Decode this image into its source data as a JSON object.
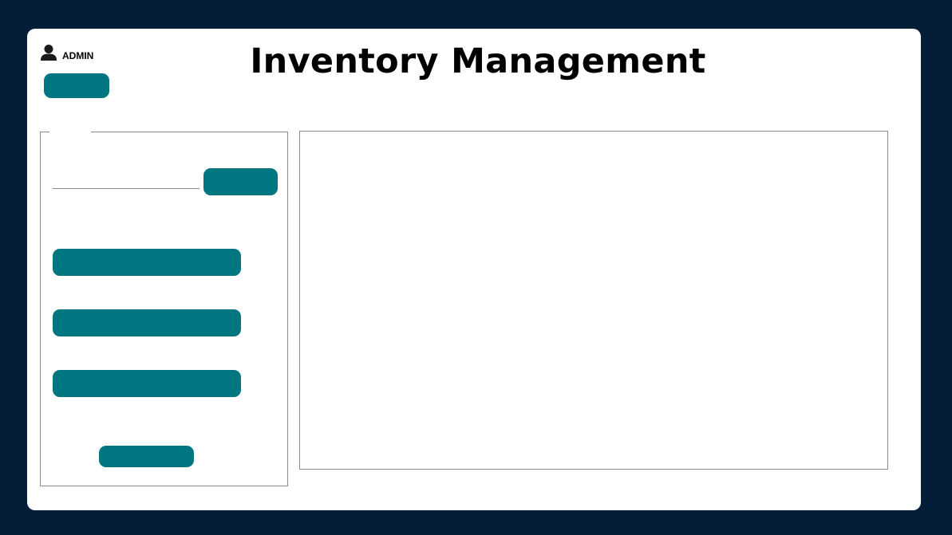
{
  "header": {
    "title": "Inventory Management",
    "user": {
      "role_label": "ADMIN",
      "icon": "user-icon"
    },
    "top_button_label": ""
  },
  "sidebar": {
    "search": {
      "value": "",
      "placeholder": "",
      "button_label": ""
    },
    "actions": [
      {
        "label": ""
      },
      {
        "label": ""
      },
      {
        "label": ""
      }
    ],
    "bottom_button_label": ""
  },
  "main": {
    "content": ""
  },
  "colors": {
    "frame": "#041d39",
    "card": "#ffffff",
    "accent": "#007681",
    "border": "#8a8a8a"
  }
}
